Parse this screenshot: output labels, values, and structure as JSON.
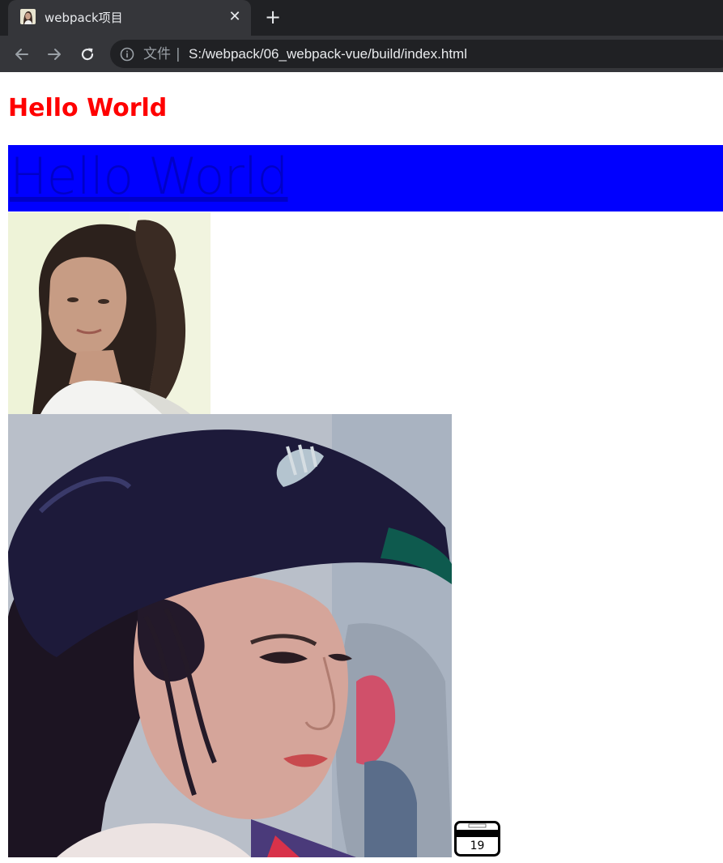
{
  "browser": {
    "tab": {
      "title": "webpack项目",
      "close_glyph": "✕",
      "favicon": "portrait-favicon-icon"
    },
    "new_tab_glyph": "+",
    "nav": {
      "back_icon": "arrow-left-icon",
      "forward_icon": "arrow-right-icon",
      "reload_icon": "reload-icon"
    },
    "omnibox": {
      "info_icon": "info-icon",
      "scheme_label": "文件",
      "separator": "|",
      "url": "S:/webpack/06_webpack-vue/build/index.html"
    },
    "colors": {
      "tabstrip_bg": "#202124",
      "toolbar_bg": "#35363a"
    }
  },
  "page": {
    "heading": "Hello World",
    "heading_color": "#ff0000",
    "blue_link_text": "Hello World",
    "blue_box_color": "#0000ff",
    "images": [
      {
        "name": "portrait-photo-1",
        "alt": "portrait photo"
      },
      {
        "name": "portrait-photo-2",
        "alt": "portrait photo with cap"
      },
      {
        "name": "small-calendar-icon",
        "alt": "small icon"
      }
    ],
    "small_icon_text": "19"
  }
}
